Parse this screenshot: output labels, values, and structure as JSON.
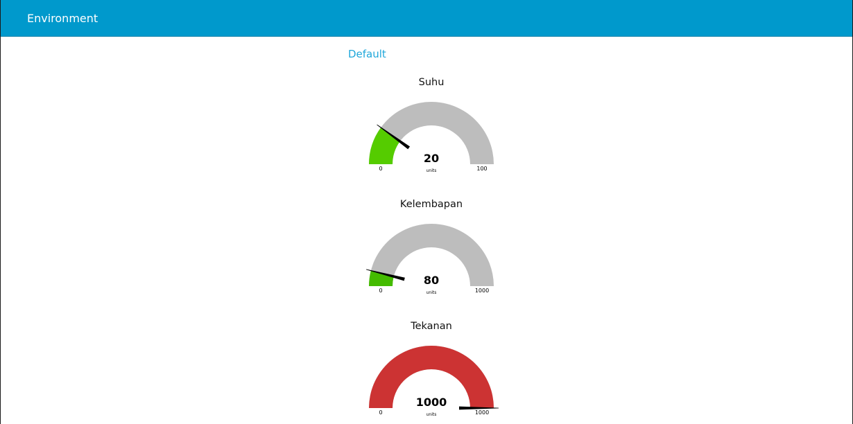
{
  "toolbar": {
    "title": "Environment"
  },
  "group": {
    "title": "Default"
  },
  "colors": {
    "toolbar_bg": "#0099cc",
    "group_title": "#1fa7da",
    "track": "#bdbdbd",
    "needle": "#000000"
  },
  "gauges": [
    {
      "label": "Suhu",
      "value": 20,
      "value_text": "20",
      "units": "units",
      "min": 0,
      "max": 100,
      "min_label": "0",
      "max_label": "100",
      "fill_color": "#55cc00"
    },
    {
      "label": "Kelembapan",
      "value": 80,
      "value_text": "80",
      "units": "units",
      "min": 0,
      "max": 1000,
      "min_label": "0",
      "max_label": "1000",
      "fill_color": "#44bb00"
    },
    {
      "label": "Tekanan",
      "value": 1000,
      "value_text": "1000",
      "units": "units",
      "min": 0,
      "max": 1000,
      "min_label": "0",
      "max_label": "1000",
      "fill_color": "#cc3333"
    }
  ]
}
